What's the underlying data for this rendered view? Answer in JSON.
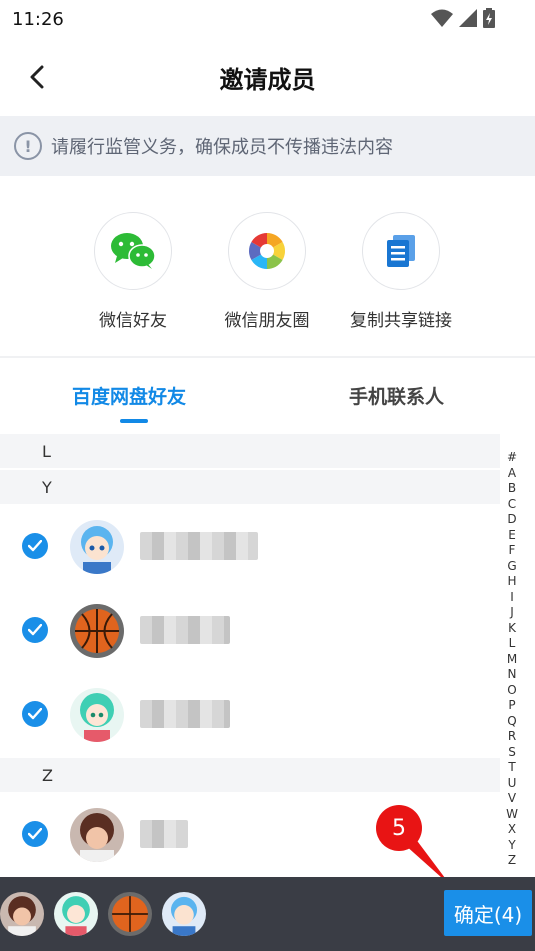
{
  "status_bar": {
    "time": "11:26"
  },
  "header": {
    "title": "邀请成员"
  },
  "notice": {
    "icon_text": "!",
    "text": "请履行监管义务，确保成员不传播违法内容"
  },
  "share": {
    "items": [
      {
        "label": "微信好友",
        "icon": "wechat-icon"
      },
      {
        "label": "微信朋友圈",
        "icon": "moments-icon"
      },
      {
        "label": "复制共享链接",
        "icon": "copy-link-icon"
      }
    ]
  },
  "tabs": [
    {
      "label": "百度网盘好友",
      "active": true
    },
    {
      "label": "手机联系人",
      "active": false
    }
  ],
  "sections": [
    {
      "letter": "L"
    },
    {
      "letter": "Y"
    },
    {
      "letter": "Z"
    }
  ],
  "index_letters": [
    "#",
    "A",
    "B",
    "C",
    "D",
    "E",
    "F",
    "G",
    "H",
    "I",
    "J",
    "K",
    "L",
    "M",
    "N",
    "O",
    "P",
    "Q",
    "R",
    "S",
    "T",
    "U",
    "V",
    "W",
    "X",
    "Y",
    "Z"
  ],
  "badge": {
    "number": "5"
  },
  "confirm": {
    "label": "确定(4)"
  },
  "colors": {
    "accent": "#1289e6",
    "badge": "#e81414",
    "bottom_bar": "#3a3d45"
  }
}
